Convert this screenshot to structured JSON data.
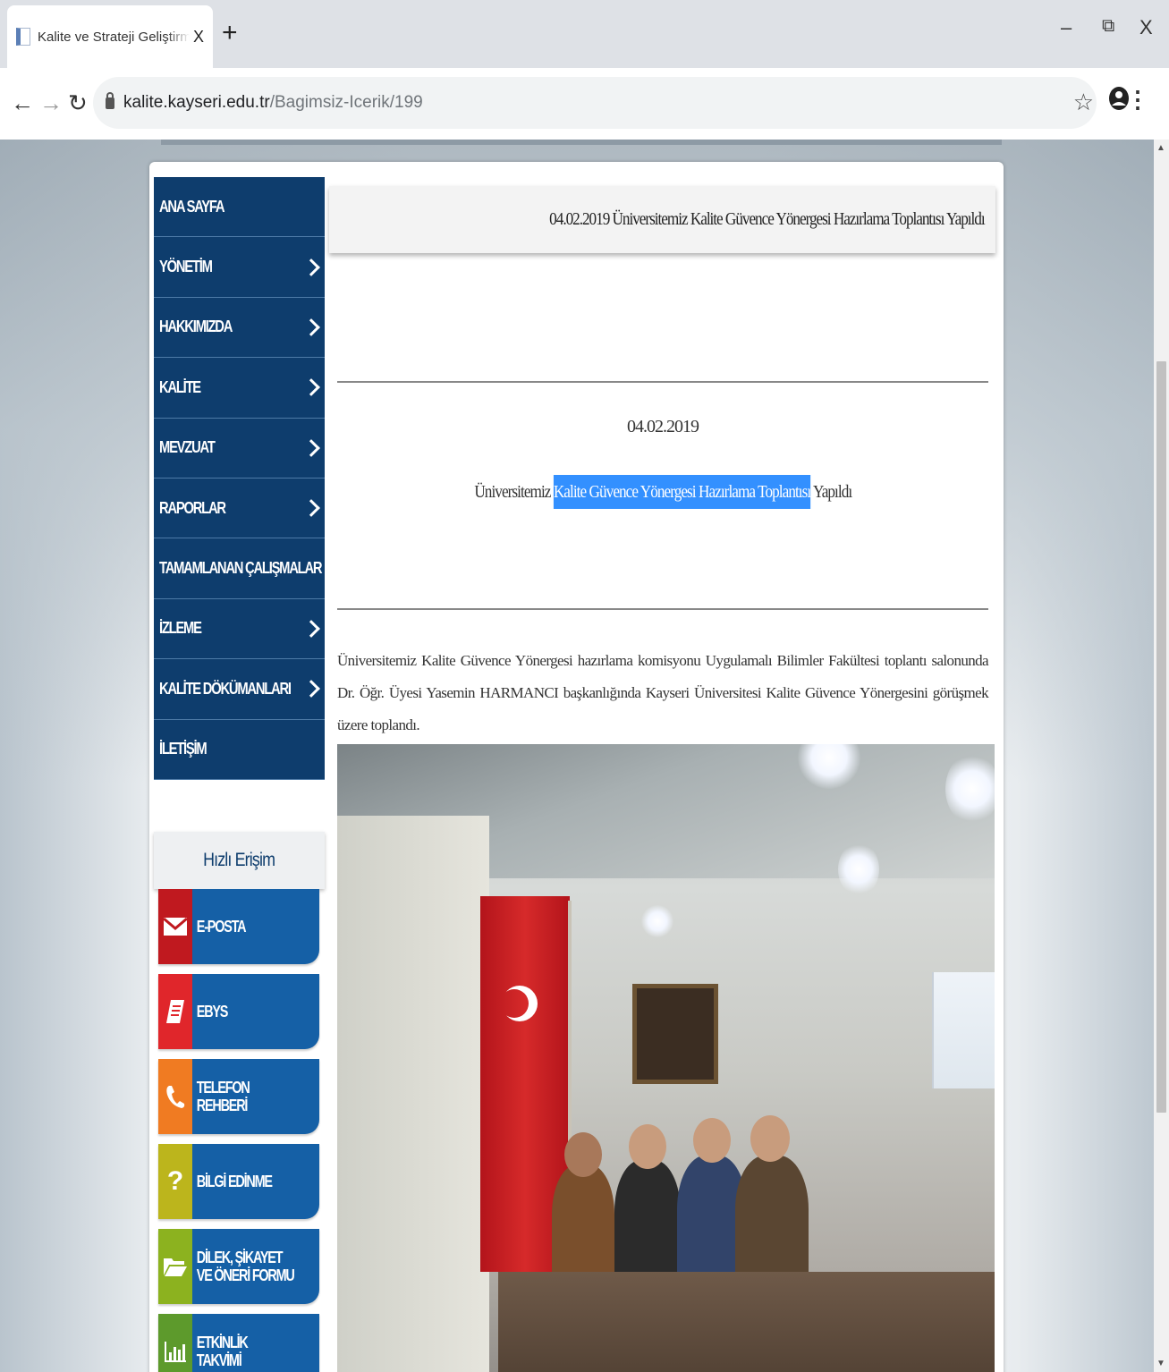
{
  "browser": {
    "tab_title": "Kalite ve Strateji Geliştirme Uygul",
    "tab_close": "X",
    "new_tab": "+",
    "window_minimize": "–",
    "window_restore": "⧉",
    "window_close": "X",
    "url_host": "kalite.kayseri.edu.tr",
    "url_path": "/Bagimsiz-Icerik/199"
  },
  "sidebar": {
    "menu": [
      {
        "label": "ANA SAYFA"
      },
      {
        "label": "YÖNETİM"
      },
      {
        "label": "HAKKIMIZDA"
      },
      {
        "label": "KALİTE"
      },
      {
        "label": "MEVZUAT"
      },
      {
        "label": "RAPORLAR"
      },
      {
        "label": "TAMAMLANAN ÇALIŞMALAR"
      },
      {
        "label": "İZLEME"
      },
      {
        "label": "KALİTE DÖKÜMANLARI"
      },
      {
        "label": "İLETİŞİM"
      }
    ],
    "quick_access_title": "Hızlı Erişim",
    "quick_access": [
      {
        "label": "E-POSTA",
        "icon": "envelope-icon",
        "color": "#c0191f"
      },
      {
        "label": "EBYS",
        "icon": "document-icon",
        "color": "#e0262b"
      },
      {
        "label": "TELEFON REHBERİ",
        "icon": "phone-icon",
        "color": "#f07b22"
      },
      {
        "label": "BİLGİ EDİNME",
        "icon": "question-icon",
        "color": "#bcb51c"
      },
      {
        "label": "DİLEK, ŞİKAYET VE ÖNERİ FORMU",
        "icon": "folder-icon",
        "color": "#8cb21f"
      },
      {
        "label": "ETKİNLİK TAKVİMİ",
        "icon": "bar-chart-icon",
        "color": "#5d9a2c"
      }
    ]
  },
  "content": {
    "title": "04.02.2019 Üniversitemiz Kalite Güvence Yönergesi Hazırlama Toplantısı Yapıldı",
    "date": "04.02.2019",
    "headline_before": "Üniversitemiz ",
    "headline_highlight": "Kalite Güvence Yönergesi Hazırlama Toplantısı",
    "headline_after": " Yapıldı",
    "body": "Üniversitemiz Kalite Güvence Yönergesi hazırlama komisyonu Uygulamalı Bilimler Fakültesi toplantı salonunda Dr. Öğr. Üyesi Yasemin HARMANCI başkanlığında Kayseri Üniversitesi Kalite Güvence Yönergesini görüşmek üzere toplandı."
  }
}
